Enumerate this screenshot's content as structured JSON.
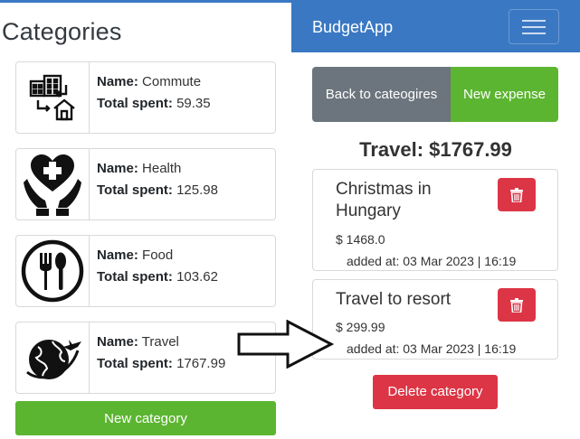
{
  "left": {
    "title": "Categories",
    "name_label": "Name:",
    "total_label": "Total spent:",
    "categories": [
      {
        "name": "Commute",
        "total": "59.35",
        "icon": "commute-icon"
      },
      {
        "name": "Health",
        "total": "125.98",
        "icon": "health-icon"
      },
      {
        "name": "Food",
        "total": "103.62",
        "icon": "food-icon"
      },
      {
        "name": "Travel",
        "total": "1767.99",
        "icon": "travel-icon"
      }
    ],
    "new_category_label": "New category"
  },
  "navbar": {
    "brand": "BudgetApp",
    "menu_icon": "hamburger-icon"
  },
  "right": {
    "back_label": "Back to cateogires",
    "new_expense_label": "New expense",
    "heading": "Travel: $1767.99",
    "expenses": [
      {
        "title": "Christmas in Hungary",
        "amount": "$ 1468.0",
        "added": "added at: 03 Mar 2023 | 16:19"
      },
      {
        "title": "Travel to resort",
        "amount": "$ 299.99",
        "added": "added at: 03 Mar 2023 | 16:19"
      }
    ],
    "delete_category_label": "Delete category"
  },
  "colors": {
    "primary": "#3a78c3",
    "success": "#5cb531",
    "secondary": "#6c757d",
    "danger": "#dc3545"
  }
}
